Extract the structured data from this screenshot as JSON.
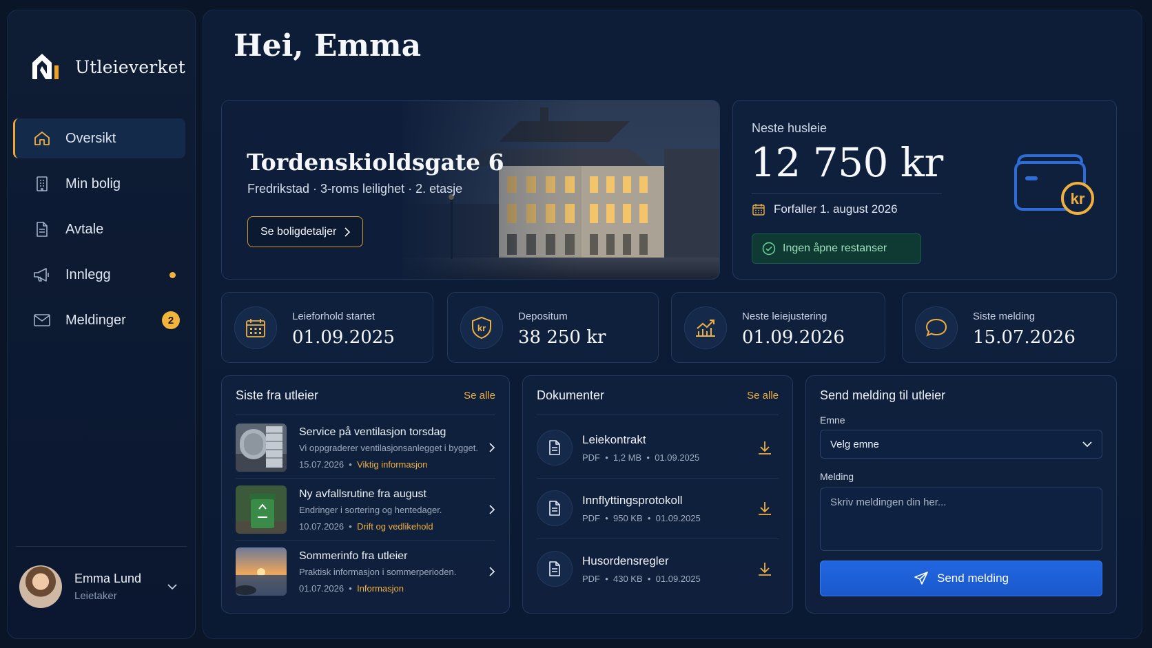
{
  "brand": {
    "name": "Utleieverket"
  },
  "nav": {
    "items": [
      {
        "label": "Oversikt",
        "icon": "home-icon"
      },
      {
        "label": "Min bolig",
        "icon": "building-icon"
      },
      {
        "label": "Avtale",
        "icon": "document-icon"
      },
      {
        "label": "Innlegg",
        "icon": "megaphone-icon"
      },
      {
        "label": "Meldinger",
        "icon": "mail-icon",
        "badge": "2"
      }
    ]
  },
  "user": {
    "name": "Emma Lund",
    "role": "Leietaker"
  },
  "greeting": "Hei, Emma",
  "property": {
    "address": "Tordenskioldsgate 6",
    "city": "Fredrikstad",
    "type": "3-roms leilighet",
    "floor": "2. etasje",
    "button": "Se boligdetaljer"
  },
  "rent": {
    "label": "Neste husleie",
    "amount": "12 750 kr",
    "due": "Forfaller 1. august 2026",
    "status": "Ingen åpne restanser",
    "wallet_symbol": "kr"
  },
  "stats": [
    {
      "label": "Leieforhold startet",
      "value": "01.09.2025",
      "icon": "calendar-icon"
    },
    {
      "label": "Depositum",
      "value": "38 250 kr",
      "icon": "shield-kr-icon",
      "symbol": "kr"
    },
    {
      "label": "Neste leiejustering",
      "value": "01.09.2026",
      "icon": "chart-up-icon"
    },
    {
      "label": "Siste melding",
      "value": "15.07.2026",
      "icon": "chat-bubble-icon"
    }
  ],
  "news": {
    "title": "Siste fra utleier",
    "see_all": "Se alle",
    "items": [
      {
        "title": "Service på ventilasjon torsdag",
        "desc": "Vi oppgraderer ventilasjonsanlegget i bygget.",
        "date": "15.07.2026",
        "tag": "Viktig informasjon"
      },
      {
        "title": "Ny avfallsrutine fra august",
        "desc": "Endringer i sortering og hentedager.",
        "date": "10.07.2026",
        "tag": "Drift og vedlikehold"
      },
      {
        "title": "Sommerinfo fra utleier",
        "desc": "Praktisk informasjon i sommerperioden.",
        "date": "01.07.2026",
        "tag": "Informasjon"
      }
    ]
  },
  "docs": {
    "title": "Dokumenter",
    "see_all": "Se alle",
    "items": [
      {
        "title": "Leiekontrakt",
        "format": "PDF",
        "size": "1,2 MB",
        "date": "01.09.2025"
      },
      {
        "title": "Innflyttingsprotokoll",
        "format": "PDF",
        "size": "950 KB",
        "date": "01.09.2025"
      },
      {
        "title": "Husordensregler",
        "format": "PDF",
        "size": "430 KB",
        "date": "01.09.2025"
      }
    ]
  },
  "message": {
    "title": "Send melding til utleier",
    "subject_label": "Emne",
    "subject_value": "Velg emne",
    "message_label": "Melding",
    "message_placeholder": "Skriv meldingen din her...",
    "send_label": "Send melding"
  },
  "colors": {
    "accent": "#f0b040",
    "primary": "#1f63dc",
    "success": "#9be0b8",
    "background": "#0a1528"
  }
}
